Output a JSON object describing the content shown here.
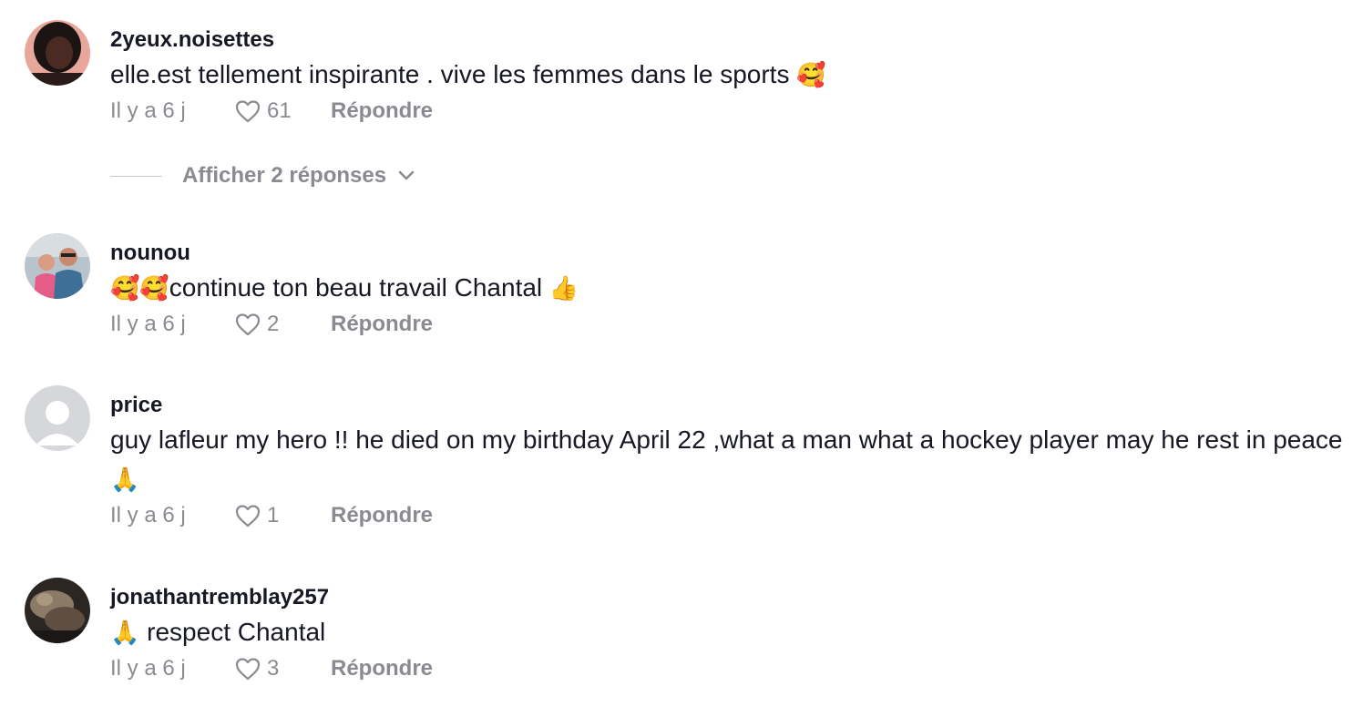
{
  "comments": [
    {
      "username": "2yeux.noisettes",
      "text": "elle.est tellement inspirante . vive les femmes dans le sports",
      "emoji_suffix": "🥰",
      "time": "Il y a 6 j",
      "likes": "61",
      "reply_label": "Répondre",
      "replies_toggle": "Afficher 2 réponses"
    },
    {
      "username": "nounou",
      "emoji_prefix": "🥰🥰",
      "text": "continue ton beau travail Chantal",
      "emoji_suffix": "👍",
      "time": "Il y a 6 j",
      "likes": "2",
      "reply_label": "Répondre"
    },
    {
      "username": "price",
      "text": "guy lafleur my hero !! he died on my birthday April 22 ,what a man what a hockey player may he rest in peace",
      "emoji_suffix": "🙏",
      "time": "Il y a 6 j",
      "likes": "1",
      "reply_label": "Répondre"
    },
    {
      "username": "jonathantremblay257",
      "emoji_prefix": "🙏",
      "text": " respect Chantal",
      "time": "Il y a 6 j",
      "likes": "3",
      "reply_label": "Répondre"
    }
  ],
  "colors": {
    "primary_text": "#161823",
    "secondary_text": "#8a8b91",
    "background": "#ffffff"
  },
  "icons": {
    "like": "heart-outline-icon",
    "expand": "chevron-down-icon"
  }
}
